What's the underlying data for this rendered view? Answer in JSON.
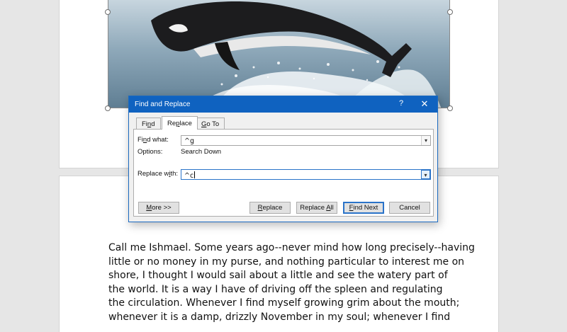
{
  "document": {
    "body_lines": [
      "Call me Ishmael. Some years ago--never mind how long precisely--having",
      "little or no money in my purse, and nothing particular to interest me on",
      "shore, I thought I would sail about a little and see the watery part of",
      "the world. It is a way I have of driving off the spleen and regulating",
      "the circulation. Whenever I find myself growing grim about the mouth;",
      "whenever it is a damp, drizzly November in my soul; whenever I find"
    ]
  },
  "dialog": {
    "title": "Find and Replace",
    "help_glyph": "?",
    "close_glyph": "✕",
    "tabs": [
      {
        "pre": "Fi",
        "key": "n",
        "post": "d"
      },
      {
        "pre": "Re",
        "key": "p",
        "post": "lace"
      },
      {
        "pre": "",
        "key": "G",
        "post": "o To"
      }
    ],
    "find_label": {
      "pre": "Fi",
      "key": "n",
      "post": "d what:"
    },
    "find_value": "^g",
    "options_label": "Options:",
    "options_value": "Search Down",
    "replace_label": {
      "pre": "Replace w",
      "key": "i",
      "post": "th:"
    },
    "replace_value": "^c",
    "buttons": {
      "more": {
        "pre": "",
        "key": "M",
        "post": "ore >>"
      },
      "replace": {
        "pre": "",
        "key": "R",
        "post": "eplace"
      },
      "replace_all": {
        "pre": "Replace ",
        "key": "A",
        "post": "ll"
      },
      "find_next": {
        "pre": "",
        "key": "F",
        "post": "ind Next"
      },
      "cancel": "Cancel"
    },
    "dropdown_glyph": "▾"
  },
  "colors": {
    "title_bar": "#0f62c0",
    "focus_border": "#2a73c9",
    "page": "#ffffff",
    "canvas": "#e6e6e6"
  }
}
